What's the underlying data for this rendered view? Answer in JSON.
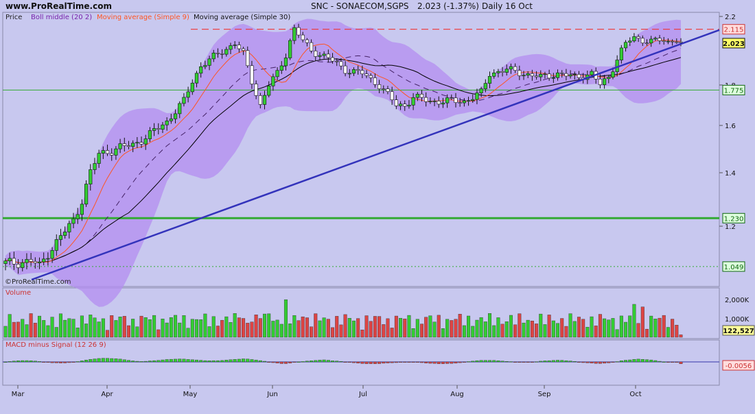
{
  "header": {
    "site": "www.ProRealTime.com",
    "title": "SNC - SONAECOM,SGPS",
    "quote": "2.023 (-1.37%)",
    "period": "Daily  16 Oct"
  },
  "watermark": "©ProRealTime.com",
  "legend": {
    "price": "Price",
    "boll": "Boll middle (20 2)",
    "ma9": "Moving average (Simple 9)",
    "ma30": "Moving average (Simple 30)"
  },
  "volume_panel": {
    "title": "Volume",
    "last_label": "122,527"
  },
  "macd_panel": {
    "title": "MACD minus Signal (12 26 9)",
    "last_label": "-0.0056"
  },
  "colors": {
    "background": "#c8c8ef",
    "band": "#b48ef0",
    "up": "#33cc33",
    "down": "#dd4444",
    "ma9": "#ff5522",
    "ma30": "#000000",
    "trendline": "#3333bb",
    "resistance": "#ee3333",
    "support": "#33aa33"
  },
  "chart_data": [
    {
      "type": "candlestick",
      "title": "SNC - SONAECOM,SGPS",
      "series_labels": [
        "Price",
        "Boll middle (20 2)",
        "Moving average (Simple 9)",
        "Moving average (Simple 30)"
      ],
      "x_ticks": [
        "Mar",
        "Apr",
        "May",
        "Jun",
        "Jul",
        "Aug",
        "Sep",
        "Oct"
      ],
      "y_ticks": [
        "2.2",
        "1.8",
        "1.6",
        "1.4",
        "1.2"
      ],
      "ylim": [
        0.99,
        2.2
      ],
      "price_labels": [
        {
          "value": 2.115,
          "label": "2.115",
          "kind": "resistance"
        },
        {
          "value": 2.023,
          "label": "2.023",
          "kind": "last"
        },
        {
          "value": 1.775,
          "label": "1.775",
          "kind": "level"
        },
        {
          "value": 1.23,
          "label": "1.230",
          "kind": "support"
        },
        {
          "value": 1.049,
          "label": "1.049",
          "kind": "low"
        }
      ],
      "trendline": {
        "from": {
          "x": "Mar",
          "y": 1.0
        },
        "to": {
          "x": "Oct",
          "y": 2.11
        }
      },
      "grid": false,
      "legend_position": "top-left"
    },
    {
      "type": "bar",
      "title": "Volume",
      "y_ticks": [
        "2,000K",
        "1,000K"
      ],
      "ylim": [
        0,
        2400000
      ],
      "last_value": 122527
    },
    {
      "type": "bar",
      "title": "MACD minus Signal (12 26 9)",
      "ylim": [
        -0.06,
        0.04
      ],
      "last_value": -0.0056
    }
  ]
}
